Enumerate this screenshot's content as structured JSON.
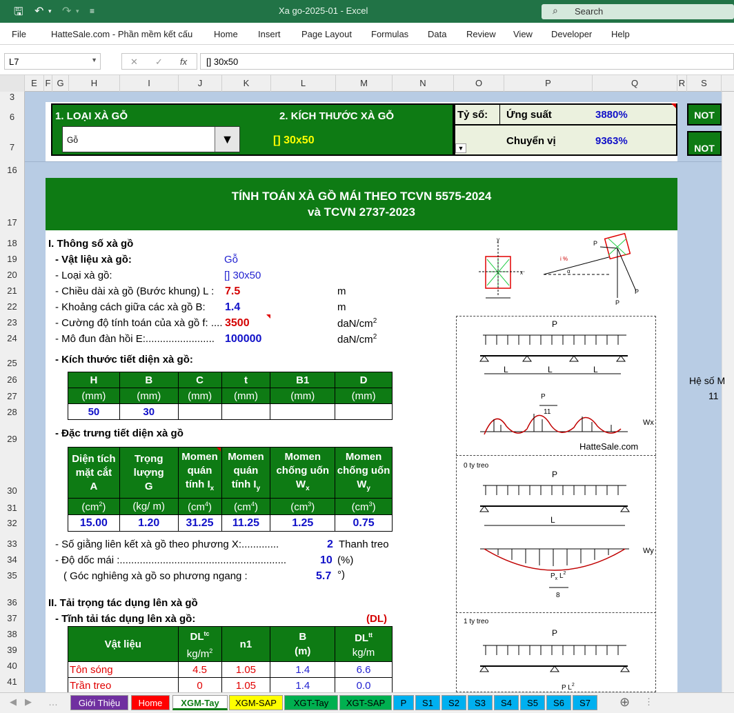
{
  "app": {
    "title": "Xa go-2025-01  -  Excel",
    "search_placeholder": "Search"
  },
  "ribbon": {
    "tabs": [
      "File",
      "HatteSale.com - Phần mềm kết cấu",
      "Home",
      "Insert",
      "Page Layout",
      "Formulas",
      "Data",
      "Review",
      "View",
      "Developer",
      "Help"
    ]
  },
  "formula_bar": {
    "name_box": "L7",
    "formula": "[] 30x50"
  },
  "columns": [
    "E",
    "F",
    "G",
    "H",
    "I",
    "J",
    "K",
    "L",
    "M",
    "N",
    "O",
    "P",
    "Q",
    "R",
    "S"
  ],
  "rows": [
    "3",
    "6",
    "7",
    "16",
    "17",
    "18",
    "19",
    "20",
    "21",
    "22",
    "23",
    "24",
    "25",
    "26",
    "27",
    "28",
    "29",
    "30",
    "31",
    "32",
    "33",
    "34",
    "35",
    "36",
    "37",
    "38",
    "39",
    "40",
    "41"
  ],
  "header_panel": {
    "h1": "1. LOẠI  XÀ GỖ",
    "h2": "2. KÍCH THƯỚC  XÀ GỖ",
    "type_value": "Gỗ",
    "size_value": "[] 30x50",
    "ratio_label": "Tỷ số:",
    "stress_label": "Ứng suất",
    "stress_value": "3880%",
    "defl_label": "Chuyển vị",
    "defl_value": "9363%",
    "status1": "NOT",
    "status2": "NOT"
  },
  "side_text": {
    "label": "Hệ số M",
    "value": "11"
  },
  "title": {
    "line1": "TÍNH TOÁN XÀ GỒ MÁI THEO TCVN 5575-2024",
    "line2": "và TCVN 2737-2023"
  },
  "section1": {
    "heading": "I. Thông số xà gồ",
    "material_label": "- Vật liệu xà gồ:",
    "material_value": "Gỗ",
    "type_label": "- Loại xà gồ:",
    "type_value": "[] 30x50",
    "length_label": "- Chiều dài xà gồ (Bước khung) L :",
    "length_value": "7.5",
    "length_unit": "m",
    "spacing_label": "- Khoảng cách giữa các xà gồ B:",
    "spacing_value": "1.4",
    "spacing_unit": "m",
    "strength_label": "- Cường độ tính toán của xà gồ f: ....",
    "strength_value": "3500",
    "strength_unit": "daN/cm",
    "modulus_label": "- Mô đun đàn hồi E:........................",
    "modulus_value": "100000",
    "modulus_unit": "daN/cm",
    "dims_heading": "- Kích thước tiết diện xà gồ:",
    "dims": {
      "headers": [
        "H",
        "B",
        "C",
        "t",
        "B1",
        "D"
      ],
      "units": [
        "(mm)",
        "(mm)",
        "(mm)",
        "(mm)",
        "(mm)",
        "(mm)"
      ],
      "values": [
        "50",
        "30",
        "",
        "",
        "",
        ""
      ]
    },
    "props_heading": "- Đặc trưng tiết diện xà gồ",
    "props": {
      "headers": [
        [
          "Diện tích",
          "mặt cắt",
          "A"
        ],
        [
          "Trọng",
          "lượng",
          "G"
        ],
        [
          "Momen",
          "quán",
          "tính I"
        ],
        [
          "Momen",
          "quán",
          "tính I"
        ],
        [
          "Momen",
          "chống uốn",
          "W"
        ],
        [
          "Momen",
          "chống uốn",
          "W"
        ]
      ],
      "subs": [
        "",
        "",
        "x",
        "y",
        "x",
        "y"
      ],
      "units": [
        "(cm",
        "(kg/ m)",
        "(cm",
        "(cm",
        "(cm",
        "(cm"
      ],
      "unit_sups": [
        "2",
        "",
        "4",
        "4",
        "3",
        "3"
      ],
      "values": [
        "15.00",
        "1.20",
        "31.25",
        "11.25",
        "1.25",
        "0.75"
      ]
    },
    "braces_label": "- Số giằng liên kết xà gồ theo phương X:.............",
    "braces_value": "2",
    "braces_unit": "Thanh treo",
    "slope_label": "- Độ dốc mái :..........................................................",
    "slope_value": "10",
    "slope_unit": "(%)",
    "angle_label": "( Góc nghiêng xà gồ so phương ngang :",
    "angle_value": "5.7",
    "angle_unit": "°)"
  },
  "section2": {
    "heading": "II. Tải trọng tác dụng lên xà gồ",
    "dead_heading": "- Tĩnh tải tác dụng lên xà gồ:",
    "dead_tag": "(DL)",
    "loads": {
      "headers": [
        "Vật liệu",
        "DL",
        "n1",
        "B",
        "DL"
      ],
      "header_sups": [
        "",
        "tc",
        "",
        "",
        "tt"
      ],
      "units": [
        "",
        "kg/m",
        "",
        "(m)",
        "kg/m"
      ],
      "rows": [
        [
          "Tôn sóng",
          "4.5",
          "1.05",
          "1.4",
          "6.6"
        ],
        [
          "Trần treo",
          "0",
          "1.05",
          "1.4",
          "0.0"
        ]
      ]
    }
  },
  "diagrams": {
    "watermark": "HatteSale.com",
    "case0": "0 ty treo",
    "case1": "1 ty treo",
    "L": "L",
    "Py": "P",
    "Px": "P",
    "P": "P",
    "Wx": "Wx",
    "Wy": "Wy",
    "pct": "i %",
    "alpha": "α",
    "frac_den1": "11",
    "frac_den2": "8"
  },
  "sheet_tabs": [
    "Giới Thiệu",
    "Home",
    "XGM-Tay",
    "XGM-SAP",
    "XGT-Tay",
    "XGT-SAP",
    "P",
    "S1",
    "S2",
    "S3",
    "S4",
    "S5",
    "S6",
    "S7"
  ],
  "colors": {
    "excel_green": "#217346",
    "panel_green": "#0e7b14",
    "sheet_bg": "#b8cce4",
    "tab_purple": "#7030a0",
    "tab_red": "#ff0000",
    "tab_yellow": "#ffff00",
    "tab_green": "#00b050",
    "tab_cyan": "#00b0f0"
  }
}
